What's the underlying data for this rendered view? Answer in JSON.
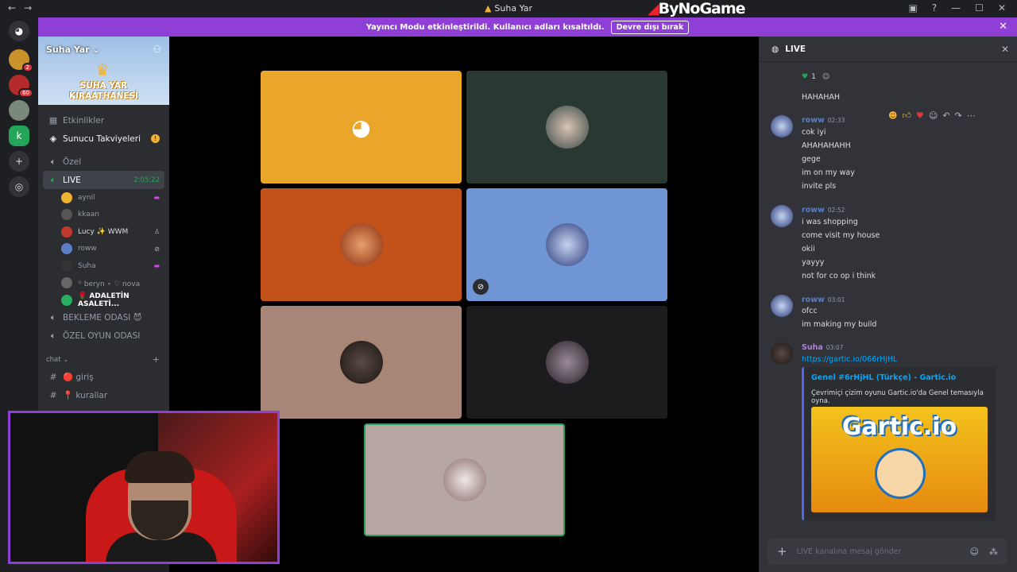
{
  "titlebar": {
    "back": "←",
    "forward": "→",
    "title": "Suha Yar",
    "brand": "ByNoGame",
    "inbox": "▣",
    "help": "?",
    "min": "—",
    "max": "☐",
    "close": "✕"
  },
  "banner": {
    "text": "Yayıncı Modu etkinleştirildi. Kullanıcı adları kısaltıldı.",
    "button": "Devre dışı bırak",
    "close": "✕"
  },
  "guilds": [
    {
      "badge": ""
    },
    {
      "badge": "2"
    },
    {
      "badge": "60"
    },
    {
      "badge": ""
    },
    {
      "badge": ""
    }
  ],
  "server": {
    "name": "Suha Yar ⌄",
    "logo_line1": "SUHA YAR",
    "logo_line2": "KIRAATHANESİ"
  },
  "channels": {
    "events": "Etkinlikler",
    "boosts": "Sunucu Takviyeleri",
    "ozel": "Özel",
    "live": "LIVE",
    "live_timer": "2:05:22",
    "users": [
      {
        "name": "aynil",
        "color": "#f0b232"
      },
      {
        "name": "kkaan",
        "color": "#555"
      },
      {
        "name": "Lucy ✨  WWM",
        "color": "#c0392b"
      },
      {
        "name": "roww",
        "color": "#5b7fc7"
      },
      {
        "name": "Suha",
        "color": "#333"
      },
      {
        "name": "꙳ beryn ⋆ ♡ nova",
        "color": "#666"
      },
      {
        "name": "🌹 ADALETİN ASALETİ...",
        "color": "#27ae60"
      }
    ],
    "bekleme": "BEKLEME ODASI 😈",
    "oyun": "ÖZEL OYUN ODASI",
    "category": "chat",
    "text_channels": [
      "🔴 giriş",
      "📍 kurallar"
    ]
  },
  "chat": {
    "header": "LIVE",
    "input_placeholder": "LIVE kanalına mesaj gönder",
    "reaction_count": "1",
    "messages_top": [
      "HAHAHAH"
    ],
    "groups": [
      {
        "author": "roww",
        "time": "02:33",
        "lines": [
          "cok iyi",
          "AHAHAHAHH",
          "gege",
          "im on my way",
          "invite pls"
        ]
      },
      {
        "author": "roww",
        "time": "02:52",
        "lines": [
          "i was shopping",
          "come visit my house",
          "okii",
          "yayyy",
          "not for co op i think"
        ]
      },
      {
        "author": "roww",
        "time": "03:01",
        "lines": [
          "ofcc",
          "im making my build"
        ]
      },
      {
        "author": "Suha",
        "time": "03:07",
        "lines": [
          "https://gartic.io/066rHjHL"
        ]
      }
    ],
    "embed": {
      "title": "Genel #6rHjHL (Türkçe) - Gartic.io",
      "desc": "Çevrimiçi çizim oyunu Gartic.io'da Genel temasıyla oyna.",
      "image_word": "Gartic.io"
    }
  }
}
